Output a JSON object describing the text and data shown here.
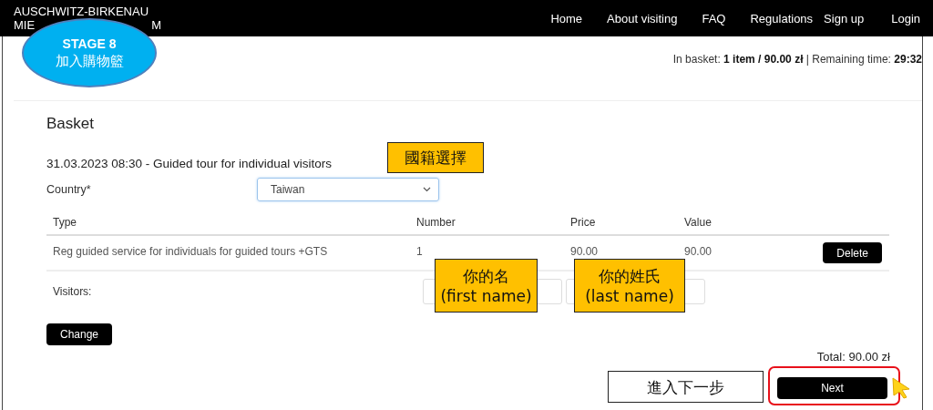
{
  "header": {
    "logo_line": "AUSCHWITZ-BIRKENAU",
    "logo_fragments": [
      "MIE",
      "M"
    ],
    "nav": [
      "Home",
      "About visiting",
      "FAQ",
      "Regulations",
      "Sign up",
      "Login"
    ]
  },
  "basket_info": "In basket: **1 item / 90.00 zł** | Remaining time: **29:32**",
  "basket": {
    "title": "Basket",
    "tour": "31.03.2023 08:30 - Guided tour for individual visitors",
    "country_label": "Country*",
    "country_value": "Taiwan",
    "columns": [
      "Type",
      "Number",
      "Price",
      "Value"
    ],
    "rows": [
      {
        "type": "Reg guided service for individuals for guided tours +GTS",
        "number": "1",
        "price": "90.00",
        "value": "90.00",
        "action": "Delete"
      }
    ],
    "visitors_label": "Visitors:",
    "change_button": "Change",
    "total": "Total: 90.00 zł",
    "next_button": "Next"
  },
  "stage_badge": {
    "title": "STAGE 8",
    "text": "加入購物籃"
  },
  "notes": [
    {
      "kind": "country",
      "lines": [
        "國籍選擇"
      ]
    },
    {
      "kind": "first_name",
      "lines": [
        "你的名",
        "(first name)"
      ]
    },
    {
      "kind": "last_name",
      "lines": [
        "你的姓氏",
        "(last name)"
      ]
    },
    {
      "kind": "next",
      "lines": [
        "進入下一步"
      ]
    }
  ]
}
